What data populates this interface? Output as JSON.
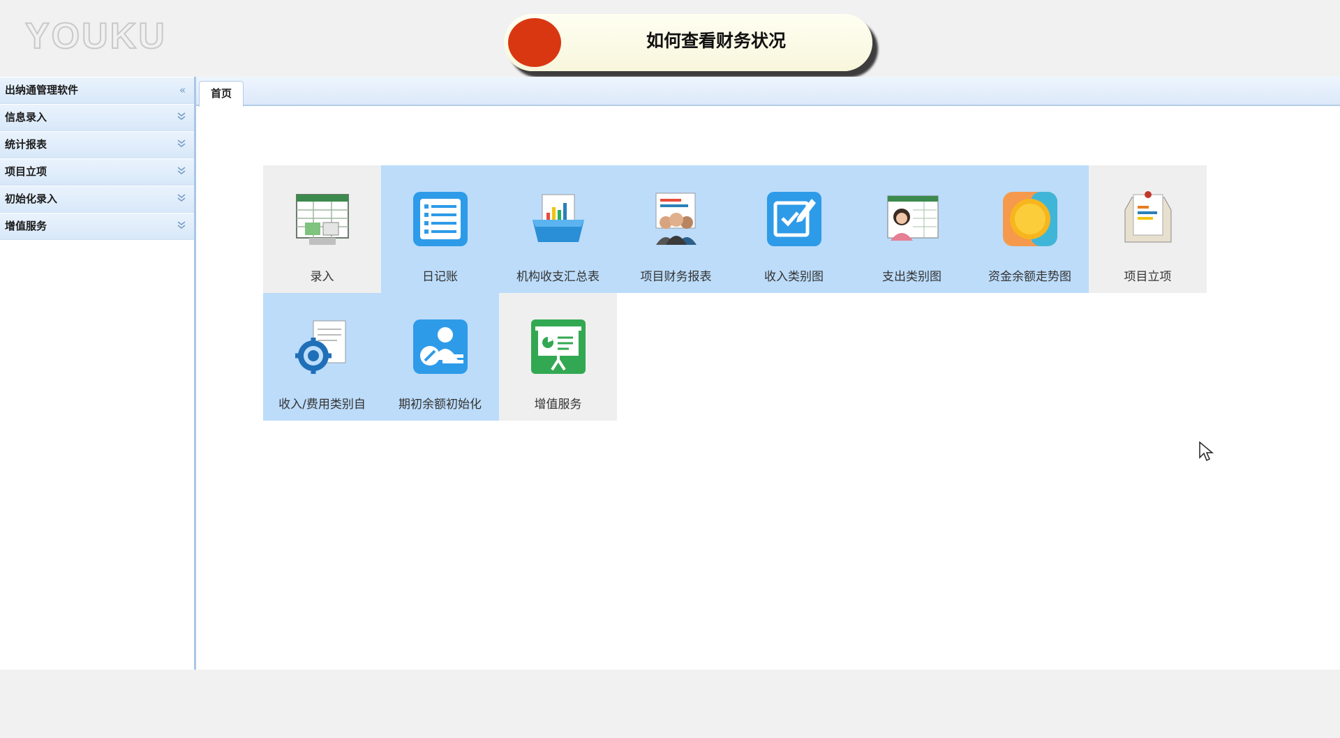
{
  "watermark": {
    "logo_text": "YOUKU"
  },
  "banner": {
    "title": "如何查看财务状况"
  },
  "sidebar": {
    "header": {
      "label": "出纳通管理软件",
      "icon": "double-chevron-left-icon"
    },
    "items": [
      {
        "label": "信息录入",
        "icon": "double-chevron-down-icon"
      },
      {
        "label": "统计报表",
        "icon": "double-chevron-down-icon"
      },
      {
        "label": "项目立项",
        "icon": "double-chevron-down-icon"
      },
      {
        "label": "初始化录入",
        "icon": "double-chevron-down-icon"
      },
      {
        "label": "增值服务",
        "icon": "double-chevron-down-icon"
      }
    ]
  },
  "tabs": [
    {
      "label": "首页",
      "active": true
    }
  ],
  "tiles": [
    {
      "label": "录入",
      "icon": "spreadsheet-entry-icon",
      "highlight": false
    },
    {
      "label": "日记账",
      "icon": "list-document-icon",
      "highlight": true
    },
    {
      "label": "机构收支汇总表",
      "icon": "folder-chart-icon",
      "highlight": true
    },
    {
      "label": "项目财务报表",
      "icon": "team-report-icon",
      "highlight": true
    },
    {
      "label": "收入类别图",
      "icon": "edit-check-icon",
      "highlight": true
    },
    {
      "label": "支出类别图",
      "icon": "person-chart-icon",
      "highlight": true
    },
    {
      "label": "资金余额走势图",
      "icon": "coin-icon",
      "highlight": true
    },
    {
      "label": "项目立项",
      "icon": "clipboard-icon",
      "highlight": false
    },
    {
      "label": "收入/费用类别自",
      "icon": "settings-gear-document-icon",
      "highlight": true
    },
    {
      "label": "期初余额初始化",
      "icon": "user-edit-icon",
      "highlight": true
    },
    {
      "label": "增值服务",
      "icon": "presentation-board-icon",
      "highlight": false
    }
  ],
  "colors": {
    "tile_highlight": "#bcdcfa",
    "tile_normal": "#efefef",
    "banner_dot": "#d93712",
    "sidebar_accent": "#7599c4"
  }
}
